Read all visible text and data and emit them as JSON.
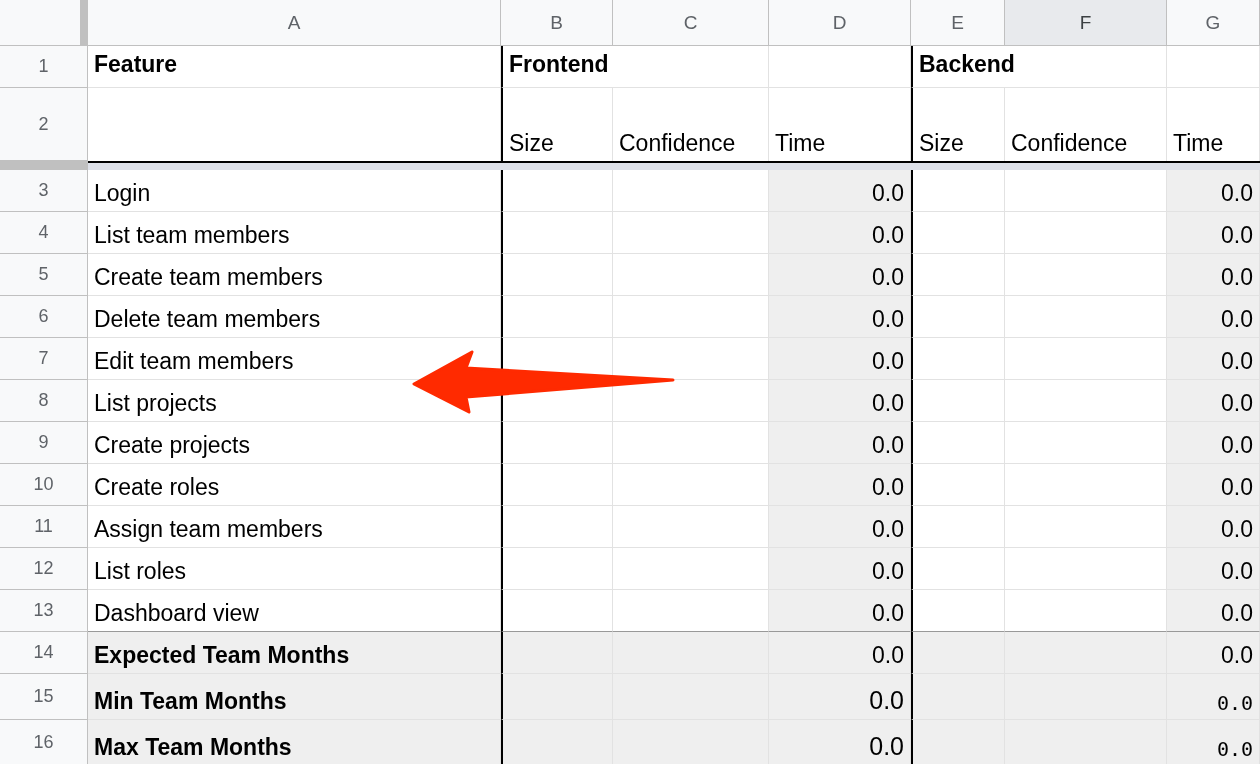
{
  "columns": [
    {
      "letter": "A",
      "selected": false
    },
    {
      "letter": "B",
      "selected": false
    },
    {
      "letter": "C",
      "selected": false
    },
    {
      "letter": "D",
      "selected": false
    },
    {
      "letter": "E",
      "selected": false
    },
    {
      "letter": "F",
      "selected": true
    },
    {
      "letter": "G",
      "selected": false
    }
  ],
  "header_row": {
    "number": "1",
    "feature": "Feature",
    "groups": [
      "Frontend",
      "Backend"
    ]
  },
  "subheader_row": {
    "number": "2",
    "groups": [
      {
        "size": "Size",
        "confidence": "Confidence",
        "time": "Time"
      },
      {
        "size": "Size",
        "confidence": "Confidence",
        "time": "Time"
      }
    ]
  },
  "rows": [
    {
      "number": "3",
      "feature": "Login",
      "times": [
        "0.0",
        "0.0"
      ]
    },
    {
      "number": "4",
      "feature": "List team members",
      "times": [
        "0.0",
        "0.0"
      ]
    },
    {
      "number": "5",
      "feature": "Create team members",
      "times": [
        "0.0",
        "0.0"
      ]
    },
    {
      "number": "6",
      "feature": "Delete team members",
      "times": [
        "0.0",
        "0.0"
      ]
    },
    {
      "number": "7",
      "feature": "Edit team members",
      "times": [
        "0.0",
        "0.0"
      ]
    },
    {
      "number": "8",
      "feature": "List projects",
      "times": [
        "0.0",
        "0.0"
      ]
    },
    {
      "number": "9",
      "feature": "Create projects",
      "times": [
        "0.0",
        "0.0"
      ]
    },
    {
      "number": "10",
      "feature": "Create roles",
      "times": [
        "0.0",
        "0.0"
      ]
    },
    {
      "number": "11",
      "feature": "Assign team members",
      "times": [
        "0.0",
        "0.0"
      ]
    },
    {
      "number": "12",
      "feature": "List roles",
      "times": [
        "0.0",
        "0.0"
      ]
    },
    {
      "number": "13",
      "feature": "Dashboard view",
      "times": [
        "0.0",
        "0.0"
      ]
    }
  ],
  "summary_rows": [
    {
      "number": "14",
      "label": "Expected Team Months",
      "times": [
        {
          "text": "0.0",
          "kind": "plain"
        },
        {
          "text": "0.0",
          "kind": "plain"
        }
      ]
    },
    {
      "number": "15",
      "label": "Min Team Months",
      "times": [
        {
          "text": "0.0",
          "kind": "large"
        },
        {
          "text": "0.0",
          "kind": "mono"
        }
      ]
    },
    {
      "number": "16",
      "label": "Max Team Months",
      "times": [
        {
          "text": "0.0",
          "kind": "large"
        },
        {
          "text": "0.0",
          "kind": "mono"
        }
      ]
    }
  ]
}
